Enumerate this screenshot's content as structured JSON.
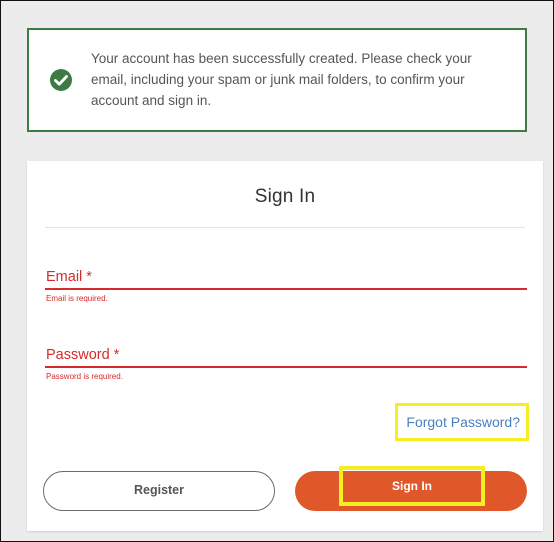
{
  "alert": {
    "icon": "check-circle-icon",
    "message": "Your account has been successfully created. Please check your email, including your spam or junk mail folders, to confirm your account and sign in.",
    "border_color": "#3d7a45"
  },
  "signin_card": {
    "title": "Sign In",
    "email": {
      "label": "Email *",
      "value": "",
      "error": "Email is required."
    },
    "password": {
      "label": "Password *",
      "value": "",
      "error": "Password is required."
    },
    "forgot_password": "Forgot Password?",
    "register_button": "Register",
    "signin_button": "Sign In"
  },
  "colors": {
    "error": "#d72a2a",
    "primary_button": "#e0582a",
    "link": "#4a7fc0",
    "highlight": "#f6ee22"
  }
}
